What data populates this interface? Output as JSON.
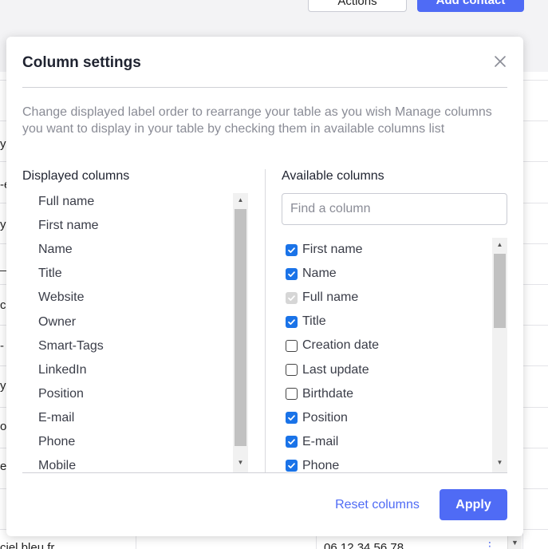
{
  "background": {
    "header_buttons": {
      "actions_label": "Actions",
      "add_contact_label": "Add contact"
    },
    "row_fragments": [
      "y",
      "-e",
      "y",
      "_",
      "c",
      "-",
      "y",
      "o",
      "e"
    ],
    "bottom_row": {
      "email_fragment": "ciel bleu.fr",
      "phone": "06 12 34 56 78"
    }
  },
  "modal": {
    "title": "Column settings",
    "description": "Change displayed label order to rearrange your table as you wish Manage columns you want to display in your table by checking them in available columns list",
    "displayed": {
      "title": "Displayed columns",
      "items": [
        "Full name",
        "First name",
        "Name",
        "Title",
        "Website",
        "Owner",
        "Smart-Tags",
        "LinkedIn",
        "Position",
        "E-mail",
        "Phone",
        "Mobile"
      ]
    },
    "available": {
      "title": "Available columns",
      "search_placeholder": "Find a column",
      "items": [
        {
          "label": "First name",
          "state": "checked"
        },
        {
          "label": "Name",
          "state": "checked"
        },
        {
          "label": "Full name",
          "state": "disabled-checked"
        },
        {
          "label": "Title",
          "state": "checked"
        },
        {
          "label": "Creation date",
          "state": "unchecked"
        },
        {
          "label": "Last update",
          "state": "unchecked"
        },
        {
          "label": "Birthdate",
          "state": "unchecked"
        },
        {
          "label": "Position",
          "state": "checked"
        },
        {
          "label": "E-mail",
          "state": "checked"
        },
        {
          "label": "Phone",
          "state": "checked"
        }
      ]
    },
    "footer": {
      "reset_label": "Reset columns",
      "apply_label": "Apply"
    },
    "colors": {
      "accent": "#4f6bf5",
      "checkbox": "#1a73e8"
    },
    "icons": {
      "close": "close-icon",
      "scroll_up": "chevron-up-icon",
      "scroll_down": "chevron-down-icon"
    }
  }
}
